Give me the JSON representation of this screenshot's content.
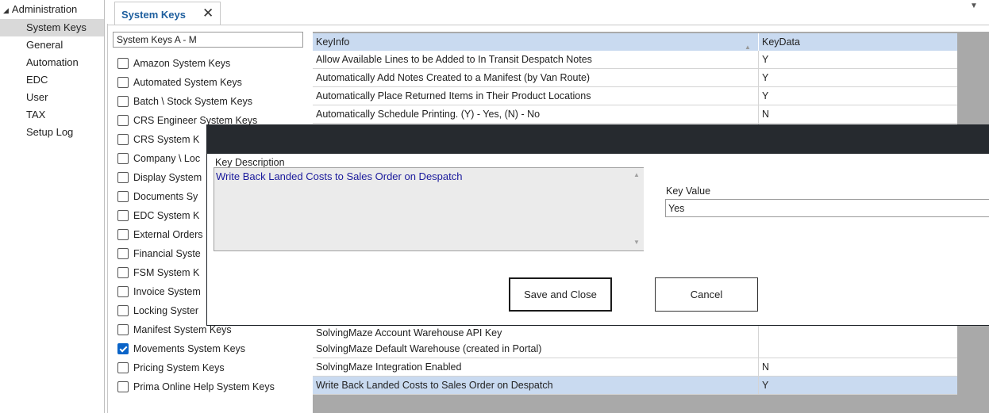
{
  "nav": {
    "root_label": "Administration",
    "items": [
      {
        "label": "System Keys",
        "selected": true
      },
      {
        "label": "General",
        "selected": false
      },
      {
        "label": "Automation",
        "selected": false
      },
      {
        "label": "EDC",
        "selected": false
      },
      {
        "label": "User",
        "selected": false
      },
      {
        "label": "TAX",
        "selected": false
      },
      {
        "label": "Setup Log",
        "selected": false
      }
    ]
  },
  "tab": {
    "label": "System Keys",
    "close_glyph": "✕",
    "dropdown_glyph": "▼"
  },
  "categories": {
    "header": "System Keys A - M",
    "items": [
      {
        "label": "Amazon System Keys",
        "checked": false
      },
      {
        "label": "Automated System Keys",
        "checked": false
      },
      {
        "label": "Batch \\ Stock System Keys",
        "checked": false
      },
      {
        "label": "CRS Engineer System Keys",
        "checked": false
      },
      {
        "label": "CRS System K",
        "checked": false
      },
      {
        "label": "Company \\ Loc",
        "checked": false
      },
      {
        "label": "Display System",
        "checked": false
      },
      {
        "label": "Documents Sy",
        "checked": false
      },
      {
        "label": "EDC System K",
        "checked": false
      },
      {
        "label": "External Orders",
        "checked": false
      },
      {
        "label": "Financial Syste",
        "checked": false
      },
      {
        "label": "FSM System K",
        "checked": false
      },
      {
        "label": "Invoice System",
        "checked": false
      },
      {
        "label": "Locking Syster",
        "checked": false
      },
      {
        "label": "Manifest System Keys",
        "checked": false
      },
      {
        "label": "Movements System Keys",
        "checked": true
      },
      {
        "label": "Pricing System Keys",
        "checked": false
      },
      {
        "label": "Prima Online Help System Keys",
        "checked": false
      }
    ]
  },
  "grid": {
    "columns": [
      "KeyInfo",
      "KeyData"
    ],
    "sort_glyph": "▲",
    "rows_top": [
      {
        "key": "Allow Available Lines to be Added to In Transit Despatch Notes",
        "value": "Y"
      },
      {
        "key": "Automatically Add Notes Created to a Manifest (by Van Route)",
        "value": "Y"
      },
      {
        "key": "Automatically Place Returned Items in Their Product Locations",
        "value": "Y"
      },
      {
        "key": "Automatically Schedule Printing. (Y) - Yes, (N) - No",
        "value": "N"
      }
    ],
    "rows_bottom": [
      {
        "key": "SolvingMaze Account Warehouse API Key",
        "value": "",
        "selected": false
      },
      {
        "key": "SolvingMaze Default Warehouse (created in Portal)",
        "value": "",
        "selected": false
      },
      {
        "key": "SolvingMaze Integration Enabled",
        "value": "N",
        "selected": false
      },
      {
        "key": "Write Back Landed Costs to Sales Order on Despatch",
        "value": "Y",
        "selected": true
      }
    ]
  },
  "dialog": {
    "key_description_label": "Key Description",
    "key_description": "Write Back Landed Costs to Sales Order on Despatch",
    "key_value_label": "Key Value",
    "key_value": "Yes",
    "save_label": "Save and Close",
    "cancel_label": "Cancel"
  },
  "colors": {
    "accent": "#1f5f9e",
    "selection": "#c9daf0",
    "dialog_title_bar": "#262a2f",
    "description_text": "#1a1a9c",
    "checkbox_checked": "#0a64c8"
  }
}
